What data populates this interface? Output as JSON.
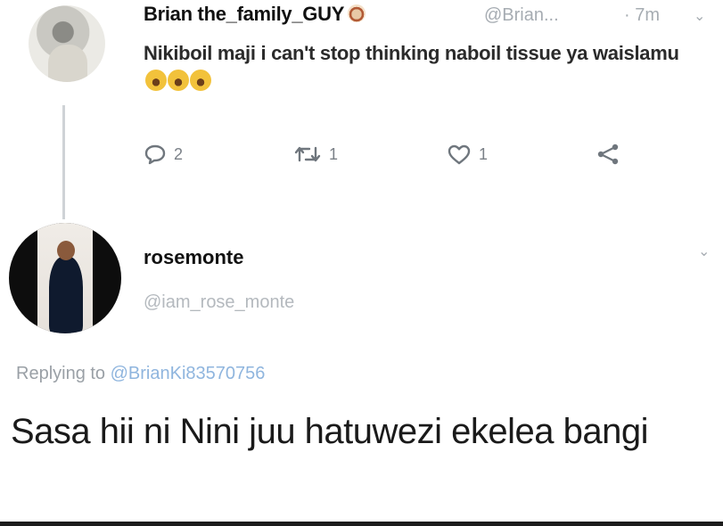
{
  "original_tweet": {
    "display_name": "Brian the_family_GUY",
    "handle": "@Brian...",
    "time": "· 7m",
    "text": "Nikiboil maji i can't stop thinking naboil tissue ya waislamu",
    "stats": {
      "replies": "2",
      "retweets": "1",
      "likes": "1"
    },
    "icons": [
      "badge-emoji-icon",
      "laugh-emoji-icon",
      "reply-icon",
      "retweet-icon",
      "like-icon",
      "share-icon",
      "chevron-down-icon"
    ]
  },
  "reply_tweet": {
    "display_name": "rosemonte",
    "handle": "@iam_rose_monte",
    "replying_prefix": "Replying to",
    "replying_to": "@BrianKi83570756",
    "text": "Sasa hii ni Nini juu hatuwezi ekelea bangi"
  },
  "colors": {
    "muted_gray": "#a6acb2",
    "mention_blue": "#8fb5de",
    "thread_line": "#cfd3d6"
  }
}
